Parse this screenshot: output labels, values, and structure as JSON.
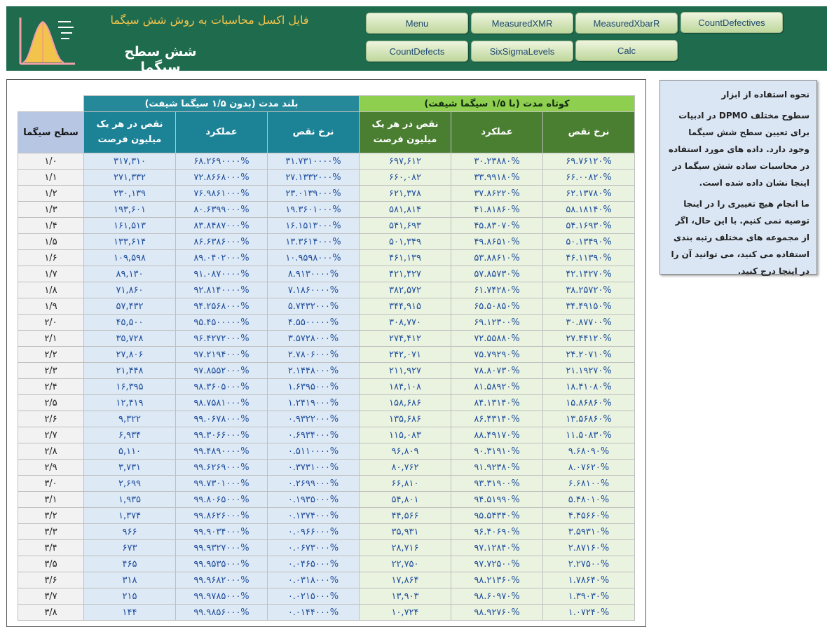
{
  "header": {
    "subtitle": "فایل اکسل محاسبات به روش شش سیگما",
    "title": "شش سطح سیگما",
    "buttons": [
      "Menu",
      "MeasuredXMR",
      "MeasuredXbarR",
      "CountDefectives",
      "CountDefects",
      "SixSigmaLevels",
      "Calc"
    ]
  },
  "table": {
    "group_short": "کوتاه مدت (با ۱/۵ سیگما شیفت)",
    "group_long": "بلند مدت (بدون ۱/۵ سیگما شیفت)",
    "col_defect_rate": "نرخ نقص",
    "col_performance": "عملکرد",
    "col_dpmo": "نقص در هر یک میلیون فرصت",
    "col_level": "سطح سیگما",
    "rows": [
      [
        "۱/۰",
        "۳۱۷,۳۱۰",
        "۶۸.۲۶۹۰۰۰۰%",
        "۳۱.۷۳۱۰۰۰۰%",
        "۶۹۷,۶۱۲",
        "۳۰.۲۳۸۸۰%",
        "۶۹.۷۶۱۲۰%"
      ],
      [
        "۱/۱",
        "۲۷۱,۳۳۲",
        "۷۲.۸۶۶۸۰۰۰%",
        "۲۷.۱۳۳۲۰۰۰%",
        "۶۶۰,۰۸۲",
        "۳۳.۹۹۱۸۰%",
        "۶۶.۰۰۸۲۰%"
      ],
      [
        "۱/۲",
        "۲۳۰,۱۳۹",
        "۷۶.۹۸۶۱۰۰۰%",
        "۲۳.۰۱۳۹۰۰۰%",
        "۶۲۱,۳۷۸",
        "۳۷.۸۶۲۲۰%",
        "۶۲.۱۳۷۸۰%"
      ],
      [
        "۱/۳",
        "۱۹۳,۶۰۱",
        "۸۰.۶۳۹۹۰۰۰%",
        "۱۹.۳۶۰۱۰۰۰%",
        "۵۸۱,۸۱۴",
        "۴۱.۸۱۸۶۰%",
        "۵۸.۱۸۱۴۰%"
      ],
      [
        "۱/۴",
        "۱۶۱,۵۱۳",
        "۸۳.۸۴۸۷۰۰۰%",
        "۱۶.۱۵۱۳۰۰۰%",
        "۵۴۱,۶۹۳",
        "۴۵.۸۳۰۷۰%",
        "۵۴.۱۶۹۳۰%"
      ],
      [
        "۱/۵",
        "۱۳۳,۶۱۴",
        "۸۶.۶۳۸۶۰۰۰%",
        "۱۳.۳۶۱۴۰۰۰%",
        "۵۰۱,۳۴۹",
        "۴۹.۸۶۵۱۰%",
        "۵۰.۱۳۴۹۰%"
      ],
      [
        "۱/۶",
        "۱۰۹,۵۹۸",
        "۸۹.۰۴۰۲۰۰۰%",
        "۱۰.۹۵۹۸۰۰۰%",
        "۴۶۱,۱۳۹",
        "۵۳.۸۸۶۱۰%",
        "۴۶.۱۱۳۹۰%"
      ],
      [
        "۱/۷",
        "۸۹,۱۳۰",
        "۹۱.۰۸۷۰۰۰۰%",
        "۸.۹۱۳۰۰۰۰%",
        "۴۲۱,۴۲۷",
        "۵۷.۸۵۷۳۰%",
        "۴۲.۱۴۲۷۰%"
      ],
      [
        "۱/۸",
        "۷۱,۸۶۰",
        "۹۲.۸۱۴۰۰۰۰%",
        "۷.۱۸۶۰۰۰۰%",
        "۳۸۲,۵۷۲",
        "۶۱.۷۴۲۸۰%",
        "۳۸.۲۵۷۲۰%"
      ],
      [
        "۱/۹",
        "۵۷,۴۳۲",
        "۹۴.۲۵۶۸۰۰۰%",
        "۵.۷۴۳۲۰۰۰%",
        "۳۴۴,۹۱۵",
        "۶۵.۵۰۸۵۰%",
        "۳۴.۴۹۱۵۰%"
      ],
      [
        "۲/۰",
        "۴۵,۵۰۰",
        "۹۵.۴۵۰۰۰۰۰%",
        "۴.۵۵۰۰۰۰۰%",
        "۳۰۸,۷۷۰",
        "۶۹.۱۲۳۰۰%",
        "۳۰.۸۷۷۰۰%"
      ],
      [
        "۲/۱",
        "۳۵,۷۲۸",
        "۹۶.۴۲۷۲۰۰۰%",
        "۳.۵۷۲۸۰۰۰%",
        "۲۷۴,۴۱۲",
        "۷۲.۵۵۸۸۰%",
        "۲۷.۴۴۱۲۰%"
      ],
      [
        "۲/۲",
        "۲۷,۸۰۶",
        "۹۷.۲۱۹۴۰۰۰%",
        "۲.۷۸۰۶۰۰۰%",
        "۲۴۲,۰۷۱",
        "۷۵.۷۹۲۹۰%",
        "۲۴.۲۰۷۱۰%"
      ],
      [
        "۲/۳",
        "۲۱,۴۴۸",
        "۹۷.۸۵۵۲۰۰۰%",
        "۲.۱۴۴۸۰۰۰%",
        "۲۱۱,۹۲۷",
        "۷۸.۸۰۷۳۰%",
        "۲۱.۱۹۲۷۰%"
      ],
      [
        "۲/۴",
        "۱۶,۳۹۵",
        "۹۸.۳۶۰۵۰۰۰%",
        "۱.۶۳۹۵۰۰۰%",
        "۱۸۴,۱۰۸",
        "۸۱.۵۸۹۲۰%",
        "۱۸.۴۱۰۸۰%"
      ],
      [
        "۲/۵",
        "۱۲,۴۱۹",
        "۹۸.۷۵۸۱۰۰۰%",
        "۱.۲۴۱۹۰۰۰%",
        "۱۵۸,۶۸۶",
        "۸۴.۱۳۱۴۰%",
        "۱۵.۸۶۸۶۰%"
      ],
      [
        "۲/۶",
        "۹,۳۲۲",
        "۹۹.۰۶۷۸۰۰۰%",
        "۰.۹۳۲۲۰۰۰%",
        "۱۳۵,۶۸۶",
        "۸۶.۴۳۱۴۰%",
        "۱۳.۵۶۸۶۰%"
      ],
      [
        "۲/۷",
        "۶,۹۳۴",
        "۹۹.۳۰۶۶۰۰۰%",
        "۰.۶۹۳۴۰۰۰%",
        "۱۱۵,۰۸۳",
        "۸۸.۴۹۱۷۰%",
        "۱۱.۵۰۸۳۰%"
      ],
      [
        "۲/۸",
        "۵,۱۱۰",
        "۹۹.۴۸۹۰۰۰۰%",
        "۰.۵۱۱۰۰۰۰%",
        "۹۶,۸۰۹",
        "۹۰.۳۱۹۱۰%",
        "۹.۶۸۰۹۰%"
      ],
      [
        "۲/۹",
        "۳,۷۳۱",
        "۹۹.۶۲۶۹۰۰۰%",
        "۰.۳۷۳۱۰۰۰%",
        "۸۰,۷۶۲",
        "۹۱.۹۲۳۸۰%",
        "۸.۰۷۶۲۰%"
      ],
      [
        "۳/۰",
        "۲,۶۹۹",
        "۹۹.۷۳۰۱۰۰۰%",
        "۰.۲۶۹۹۰۰۰%",
        "۶۶,۸۱۰",
        "۹۳.۳۱۹۰۰%",
        "۶.۶۸۱۰۰%"
      ],
      [
        "۳/۱",
        "۱,۹۳۵",
        "۹۹.۸۰۶۵۰۰۰%",
        "۰.۱۹۳۵۰۰۰%",
        "۵۴,۸۰۱",
        "۹۴.۵۱۹۹۰%",
        "۵.۴۸۰۱۰%"
      ],
      [
        "۳/۲",
        "۱,۳۷۴",
        "۹۹.۸۶۲۶۰۰۰%",
        "۰.۱۳۷۴۰۰۰%",
        "۴۴,۵۶۶",
        "۹۵.۵۴۳۴۰%",
        "۴.۴۵۶۶۰%"
      ],
      [
        "۳/۳",
        "۹۶۶",
        "۹۹.۹۰۳۴۰۰۰%",
        "۰.۰۹۶۶۰۰۰%",
        "۳۵,۹۳۱",
        "۹۶.۴۰۶۹۰%",
        "۳.۵۹۳۱۰%"
      ],
      [
        "۳/۴",
        "۶۷۳",
        "۹۹.۹۳۲۷۰۰۰%",
        "۰.۰۶۷۳۰۰۰%",
        "۲۸,۷۱۶",
        "۹۷.۱۲۸۴۰%",
        "۲.۸۷۱۶۰%"
      ],
      [
        "۳/۵",
        "۴۶۵",
        "۹۹.۹۵۳۵۰۰۰%",
        "۰.۰۴۶۵۰۰۰%",
        "۲۲,۷۵۰",
        "۹۷.۷۲۵۰۰%",
        "۲.۲۷۵۰۰%"
      ],
      [
        "۳/۶",
        "۳۱۸",
        "۹۹.۹۶۸۲۰۰۰%",
        "۰.۰۳۱۸۰۰۰%",
        "۱۷,۸۶۴",
        "۹۸.۲۱۳۶۰%",
        "۱.۷۸۶۴۰%"
      ],
      [
        "۳/۷",
        "۲۱۵",
        "۹۹.۹۷۸۵۰۰۰%",
        "۰.۰۲۱۵۰۰۰%",
        "۱۳,۹۰۳",
        "۹۸.۶۰۹۷۰%",
        "۱.۳۹۰۳۰%"
      ],
      [
        "۳/۸",
        "۱۴۴",
        "۹۹.۹۸۵۶۰۰۰%",
        "۰.۰۱۴۴۰۰۰%",
        "۱۰,۷۲۴",
        "۹۸.۹۲۷۶۰%",
        "۱.۰۷۲۴۰%"
      ]
    ]
  },
  "note": {
    "title": "نحوه استفاده از ابزار",
    "p1": "سطوح مختلف DPMO در ادبیات برای تعیین سطح شش سیگما وجود دارد. داده های مورد استفاده در محاسبات ساده شش سیگما در اینجا نشان داده شده است.",
    "p2": "ما انجام هیچ تغییری را در اینجا توصیه نمی کنیم. با این حال، اگر از مجموعه های مختلف رتبه بندی استفاده می کنید، می توانید آن را در اینجا درج کنید."
  },
  "colors": {
    "banner": "#1e6b4e",
    "title_gold": "#f2c44b",
    "short_header": "#8fcf4f",
    "long_header": "#25899a",
    "value_blue": "#1f4e9c"
  }
}
